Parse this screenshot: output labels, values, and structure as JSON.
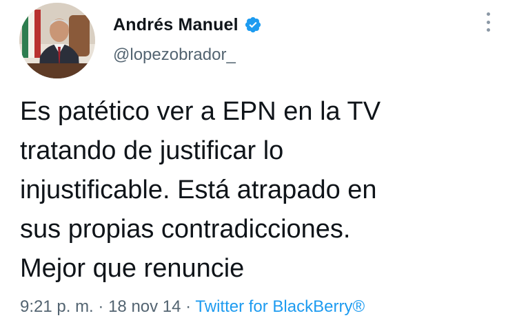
{
  "tweet": {
    "author": {
      "display_name": "Andrés Manuel",
      "handle": "@lopezobrador_",
      "verified": true,
      "avatar_icon": "profile-photo"
    },
    "text": "Es patético ver a EPN en la TV\ntratando de justificar lo\ninjustificable. Está atrapado en\nsus propias contradicciones.\nMejor que renuncie",
    "time": "9:21 p. m.",
    "separator": "·",
    "date": "18 nov 14",
    "source": "Twitter for BlackBerry®",
    "menu_icon": "more-options-icon"
  },
  "colors": {
    "text": "#0f1419",
    "secondary": "#536471",
    "link": "#1d9bf0",
    "verified_badge": "#1d9bf0"
  }
}
